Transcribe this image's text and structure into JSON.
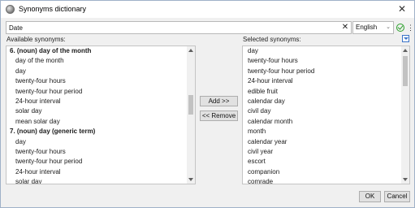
{
  "window": {
    "title": "Synonyms dictionary",
    "close_glyph": "✕"
  },
  "search": {
    "value": "Date",
    "clear_glyph": "✕",
    "language": "English",
    "language_chevron": "⌄",
    "status_icon": "check-circle-icon",
    "status_color": "#2aa02a",
    "more_glyph": "⋮"
  },
  "available": {
    "label": "Available synonyms:",
    "items": [
      {
        "text": "6. (noun) day of the month",
        "kind": "header"
      },
      {
        "text": "day of the month",
        "kind": "sub"
      },
      {
        "text": "day",
        "kind": "sub"
      },
      {
        "text": "twenty-four hours",
        "kind": "sub"
      },
      {
        "text": "twenty-four hour period",
        "kind": "sub"
      },
      {
        "text": "24-hour interval",
        "kind": "sub"
      },
      {
        "text": "solar day",
        "kind": "sub"
      },
      {
        "text": "mean solar day",
        "kind": "sub"
      },
      {
        "text": "7. (noun) day (generic term)",
        "kind": "header"
      },
      {
        "text": "day",
        "kind": "sub"
      },
      {
        "text": "twenty-four hours",
        "kind": "sub"
      },
      {
        "text": "twenty-four hour period",
        "kind": "sub"
      },
      {
        "text": "24-hour interval",
        "kind": "sub"
      },
      {
        "text": "solar day",
        "kind": "sub"
      }
    ]
  },
  "selected": {
    "label": "Selected synonyms:",
    "items": [
      "day",
      "twenty-four hours",
      "twenty-four hour period",
      "24-hour interval",
      "edible fruit",
      "calendar day",
      "civil day",
      "calendar month",
      "month",
      "calendar year",
      "civil year",
      "escort",
      "companion",
      "comrade"
    ]
  },
  "actions": {
    "add_label": "Add >>",
    "remove_label": "<< Remove",
    "ok_label": "OK",
    "cancel_label": "Cancel"
  },
  "colors": {
    "accent": "#3a73c9",
    "list_bg": "#ffffff",
    "window_bg": "#f0f0f0"
  }
}
